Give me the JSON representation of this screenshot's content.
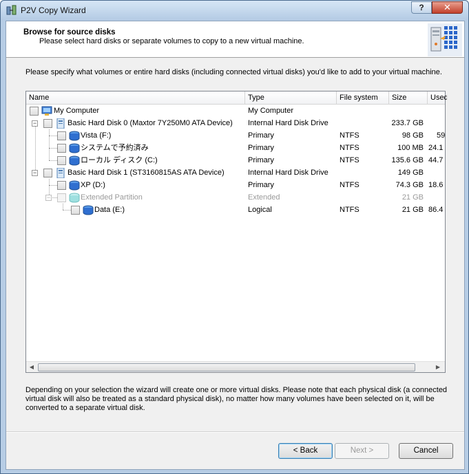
{
  "window": {
    "title": "P2V Copy Wizard",
    "help_glyph": "?",
    "close_glyph": "✕"
  },
  "header": {
    "title": "Browse for source disks",
    "subtitle": "Please select hard disks or separate volumes to copy to a new virtual machine."
  },
  "instructions": "Please specify what volumes or entire hard disks (including connected virtual disks) you'd like to add to your virtual machine.",
  "columns": [
    "Name",
    "Type",
    "File system",
    "Size",
    "Used"
  ],
  "rows": [
    {
      "name": "My Computer",
      "type": "My Computer",
      "fs": "",
      "size": "",
      "used": "",
      "icon": "computer-icon",
      "disabled": false
    },
    {
      "name": "Basic Hard Disk 0 (Maxtor 7Y250M0 ATA Device)",
      "type": "Internal Hard Disk Drive",
      "fs": "",
      "size": "233.7 GB",
      "used": "",
      "icon": "hard-disk-icon",
      "disabled": false
    },
    {
      "name": "Vista (F:)",
      "type": "Primary",
      "fs": "NTFS",
      "size": "98 GB",
      "used": "59",
      "icon": "volume-icon",
      "disabled": false
    },
    {
      "name": "システムで予約済み",
      "type": "Primary",
      "fs": "NTFS",
      "size": "100 MB",
      "used": "24.1",
      "icon": "volume-icon",
      "disabled": false
    },
    {
      "name": "ローカル ディスク (C:)",
      "type": "Primary",
      "fs": "NTFS",
      "size": "135.6 GB",
      "used": "44.7",
      "icon": "volume-icon",
      "disabled": false
    },
    {
      "name": "Basic Hard Disk 1 (ST3160815AS ATA Device)",
      "type": "Internal Hard Disk Drive",
      "fs": "",
      "size": "149 GB",
      "used": "",
      "icon": "hard-disk-icon",
      "disabled": false
    },
    {
      "name": "XP (D:)",
      "type": "Primary",
      "fs": "NTFS",
      "size": "74.3 GB",
      "used": "18.6",
      "icon": "volume-icon",
      "disabled": false
    },
    {
      "name": "Extended Partition",
      "type": "Extended",
      "fs": "",
      "size": "21 GB",
      "used": "",
      "icon": "extended-partition-icon",
      "disabled": true
    },
    {
      "name": "Data (E:)",
      "type": "Logical",
      "fs": "NTFS",
      "size": "21 GB",
      "used": "86.4",
      "icon": "volume-icon",
      "disabled": false
    }
  ],
  "scroll": {
    "left_arrow": "◀",
    "right_arrow": "▶"
  },
  "note": "Depending on your selection the wizard will create one or more virtual disks. Please note that each physical disk (a connected virtual disk will also be treated as a standard physical disk), no matter how many volumes have been selected on it, will be converted to a separate virtual disk.",
  "buttons": {
    "back": "< Back",
    "next": "Next >",
    "cancel": "Cancel"
  },
  "expander_glyph": "−"
}
